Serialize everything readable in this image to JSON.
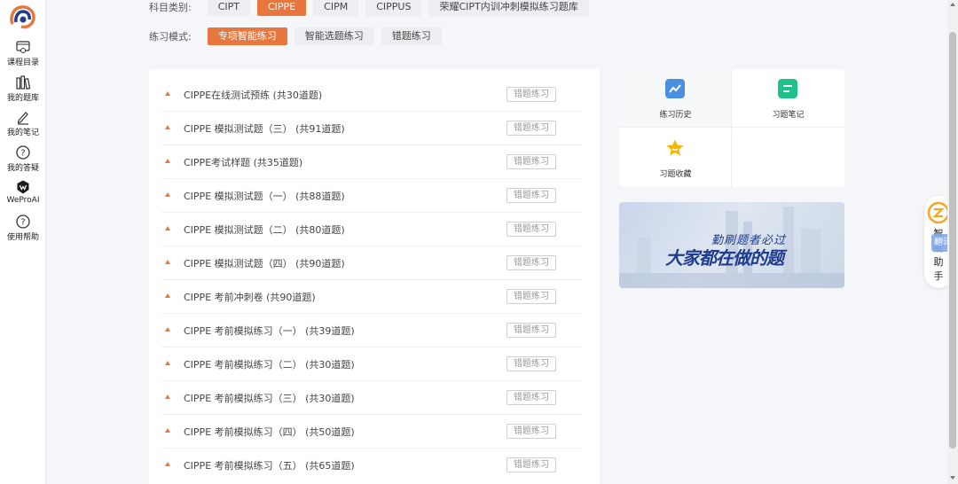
{
  "sidebar": {
    "logo": "weprolearn-logo",
    "items": [
      {
        "label": "课程目录",
        "icon": "course-catalog-icon"
      },
      {
        "label": "我的题库",
        "icon": "question-bank-icon"
      },
      {
        "label": "我的笔记",
        "icon": "notes-pen-icon"
      },
      {
        "label": "我的答疑",
        "icon": "question-help-icon"
      },
      {
        "label": "WeProAI",
        "icon": "weproai-icon"
      },
      {
        "label": "使用帮助",
        "icon": "help-icon"
      }
    ]
  },
  "filters": {
    "subject_label": "科目类别:",
    "subjects": [
      "CIPT",
      "CIPPE",
      "CIPM",
      "CIPPUS",
      "荣耀CIPT内训冲刺模拟练习题库"
    ],
    "subject_active": "CIPPE",
    "mode_label": "练习模式:",
    "modes": [
      "专项智能练习",
      "智能选题练习",
      "错题练习"
    ],
    "mode_active": "专项智能练习"
  },
  "exercises": [
    {
      "title": "CIPPE在线测试预练 (共30道题)",
      "button": "错题练习"
    },
    {
      "title": "CIPPE 模拟测试题（三） (共91道题)",
      "button": "错题练习"
    },
    {
      "title": "CIPPE考试样题 (共35道题)",
      "button": "错题练习"
    },
    {
      "title": "CIPPE 模拟测试题（一） (共88道题)",
      "button": "错题练习"
    },
    {
      "title": "CIPPE 模拟测试题（二） (共80道题)",
      "button": "错题练习"
    },
    {
      "title": "CIPPE 模拟测试题（四） (共90道题)",
      "button": "错题练习"
    },
    {
      "title": "CIPPE 考前冲刺卷 (共90道题)",
      "button": "错题练习"
    },
    {
      "title": "CIPPE 考前模拟练习（一） (共39道题)",
      "button": "错题练习"
    },
    {
      "title": "CIPPE 考前模拟练习（二） (共30道题)",
      "button": "错题练习"
    },
    {
      "title": "CIPPE 考前模拟练习（三） (共30道题)",
      "button": "错题练习"
    },
    {
      "title": "CIPPE 考前模拟练习（四） (共50道题)",
      "button": "错题练习"
    },
    {
      "title": "CIPPE 考前模拟练习（五） (共65道题)",
      "button": "错题练习"
    }
  ],
  "tools": [
    {
      "label": "练习历史",
      "icon": "chart-trend-icon",
      "color": "#4a90e2"
    },
    {
      "label": "习题笔记",
      "icon": "note-list-icon",
      "color": "#1fc18a"
    },
    {
      "label": "习题收藏",
      "icon": "star-icon",
      "color": "#f5b800"
    }
  ],
  "banner": {
    "slogan_small": "勤刷题者必过",
    "slogan_big": "大家都在做的题",
    "color": "#1f3c8f"
  },
  "assistant": {
    "text": "智能助手",
    "translate": "翻译"
  },
  "colors": {
    "accent": "#e8773f",
    "chip_bg": "#eceef1"
  }
}
